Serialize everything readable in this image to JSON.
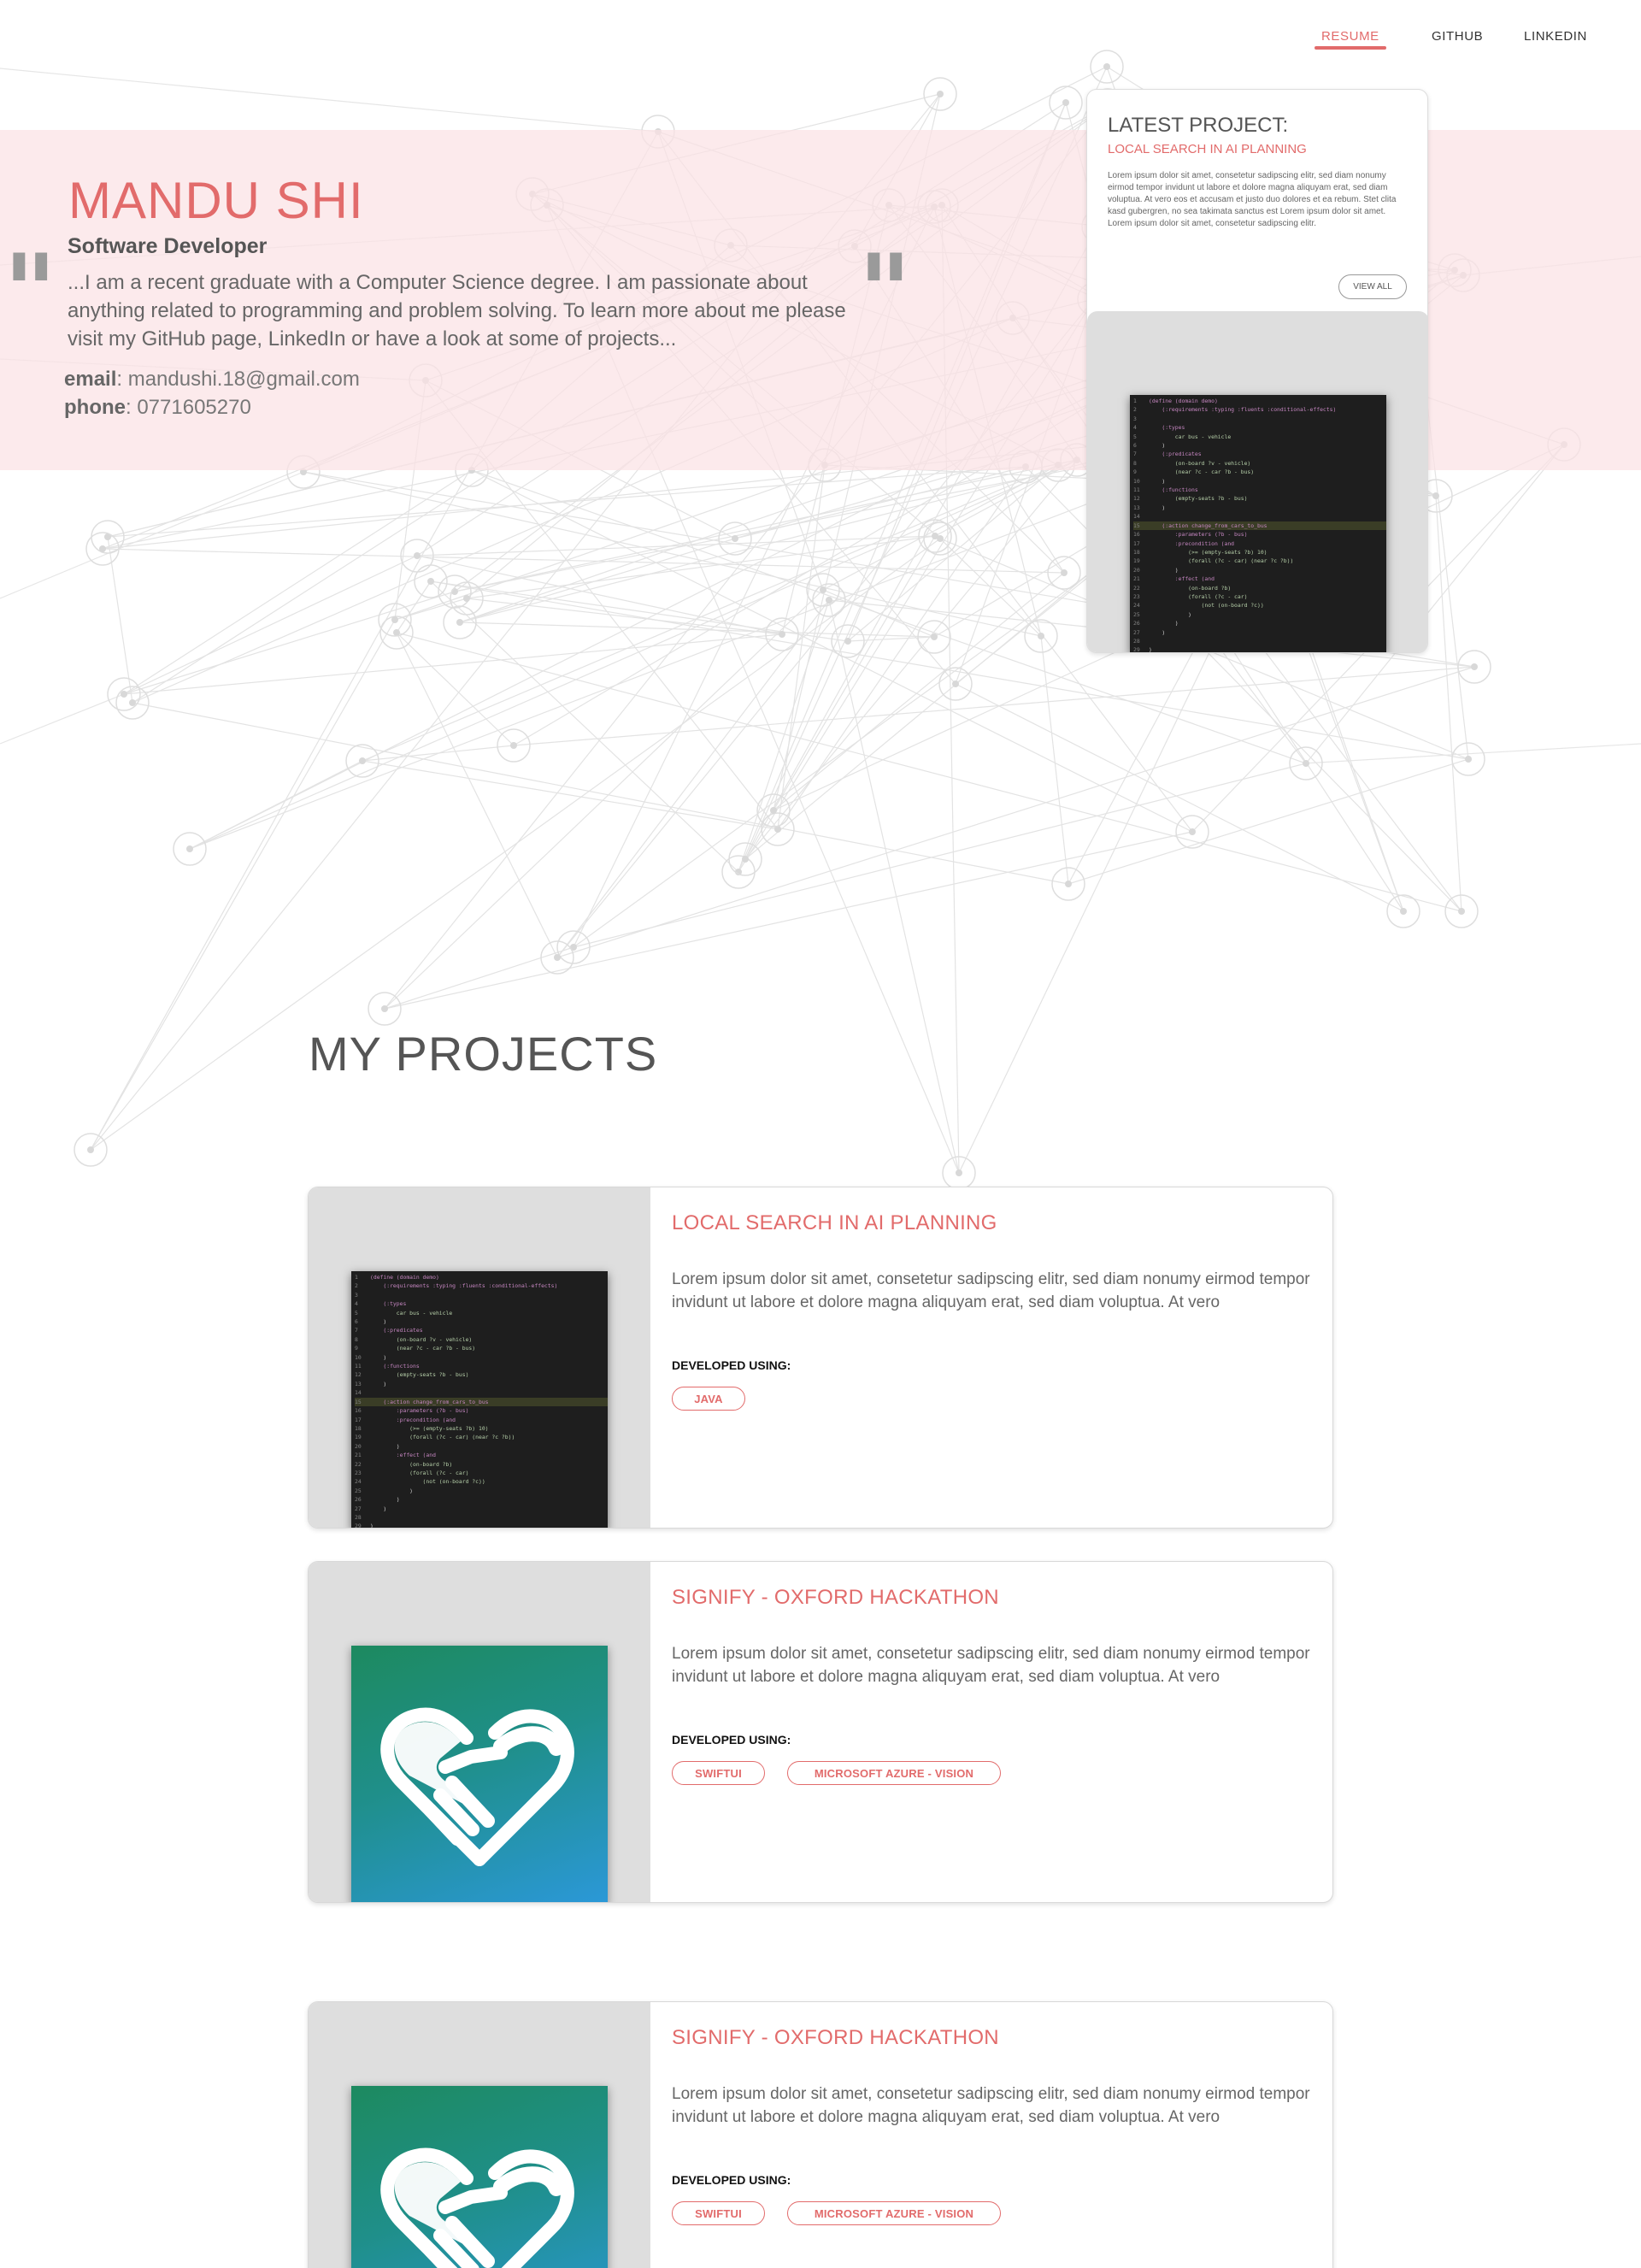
{
  "nav": {
    "items": [
      {
        "label": "RESUME",
        "active": true
      },
      {
        "label": "GITHUB",
        "active": false
      },
      {
        "label": "LINKEDIN",
        "active": false
      }
    ]
  },
  "hero": {
    "name": "MANDU SHI",
    "role": "Software Developer",
    "bio": "...I am a recent graduate with a Computer Science degree. I am passionate about anything related to programming and problem solving. To learn more about me please visit my GitHub page, LinkedIn or have a look at some of projects...",
    "email_label": "email",
    "email": ": mandushi.18@gmail.com",
    "phone_label": "phone",
    "phone": ": 0771605270"
  },
  "latest": {
    "title": "LATEST PROJECT:",
    "subtitle": "LOCAL SEARCH IN AI PLANNING",
    "text": "Lorem ipsum dolor sit amet, consetetur sadipscing elitr, sed diam nonumy eirmod tempor invidunt ut labore et dolore magna aliquyam erat, sed diam voluptua. At vero eos et accusam et justo duo dolores et ea rebum. Stet clita kasd gubergren, no sea takimata sanctus est Lorem ipsum dolor sit amet. Lorem ipsum dolor sit amet, consetetur sadipscing elitr.",
    "view_all": "VIEW ALL"
  },
  "code_lines": [
    "(define (domain demo)",
    "    (:requirements :typing :fluents :conditional-effects)",
    "",
    "    (:types",
    "        car bus - vehicle",
    "    )",
    "    (:predicates",
    "        (on-board ?v - vehicle)",
    "        (near ?c - car ?b - bus)",
    "    )",
    "    (:functions",
    "        (empty-seats ?b - bus)",
    "    )",
    "",
    "    (:action change_from_cars_to_bus",
    "        :parameters (?b - bus)",
    "        :precondition (and",
    "            (>= (empty-seats ?b) 10)",
    "            (forall (?c - car) (near ?c ?b))",
    "        )",
    "        :effect (and",
    "            (on-board ?b)",
    "            (forall (?c - car)",
    "                (not (on-board ?c))",
    "            )",
    "        )",
    "    )",
    "",
    ")"
  ],
  "projects_section": {
    "title": "MY PROJECTS"
  },
  "projects": [
    {
      "title": "LOCAL SEARCH IN AI PLANNING",
      "description": "Lorem ipsum dolor sit amet, consetetur sadipscing elitr, sed diam nonumy eirmod tempor invidunt ut labore et dolore magna aliquyam erat, sed diam voluptua. At vero",
      "developed_label": "DEVELOPED USING:",
      "tags": [
        "JAVA"
      ],
      "image": "code-screenshot"
    },
    {
      "title": "SIGNIFY - OXFORD HACKATHON",
      "description": "Lorem ipsum dolor sit amet, consetetur sadipscing elitr, sed diam nonumy eirmod tempor invidunt ut labore et dolore magna aliquyam erat, sed diam voluptua. At vero",
      "developed_label": "DEVELOPED USING:",
      "tags": [
        "SWIFTUI",
        "MICROSOFT AZURE - VISION"
      ],
      "image": "heart-hands-icon"
    },
    {
      "title": "SIGNIFY - OXFORD HACKATHON",
      "description": "Lorem ipsum dolor sit amet, consetetur sadipscing elitr, sed diam nonumy eirmod tempor invidunt ut labore et dolore magna aliquyam erat, sed diam voluptua. At vero",
      "developed_label": "DEVELOPED USING:",
      "tags": [
        "SWIFTUI",
        "MICROSOFT AZURE - VISION"
      ],
      "image": "heart-hands-icon"
    }
  ],
  "colors": {
    "accent": "#e26b6b",
    "hero_band": "#fbe2e5",
    "text": "#555555",
    "card_border": "#d8d8d8"
  }
}
